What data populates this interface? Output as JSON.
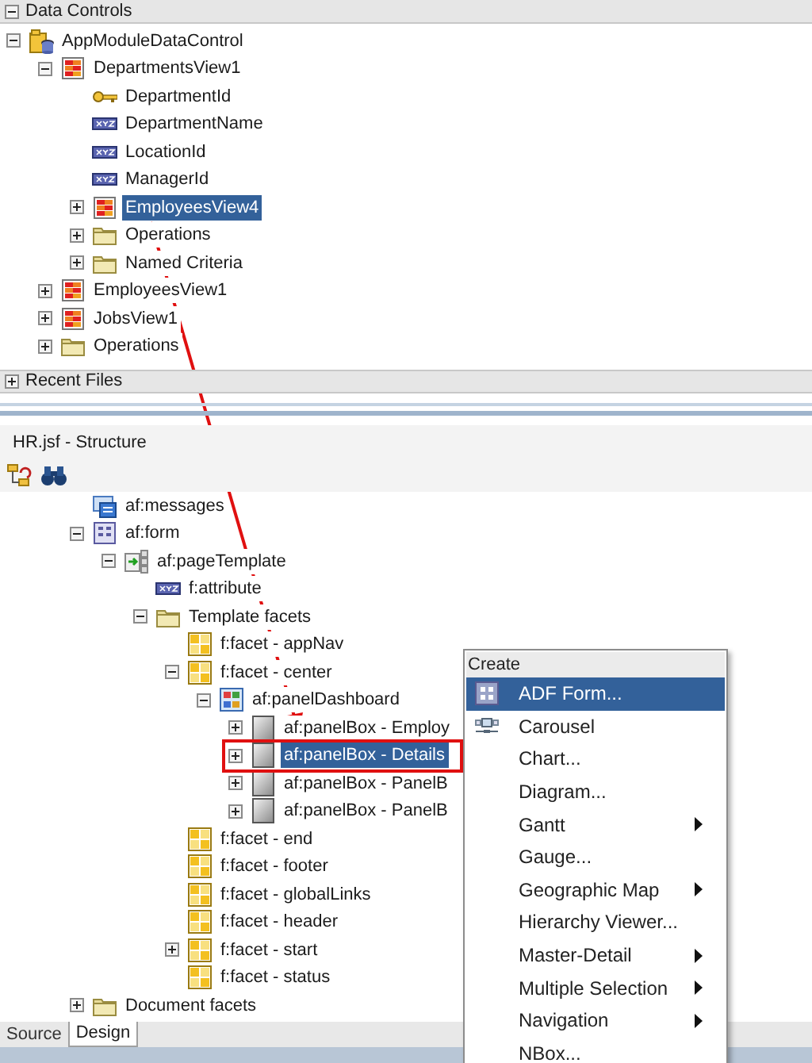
{
  "data_controls": {
    "title": "Data Controls",
    "expanded": true,
    "tree": [
      {
        "label": "AppModuleDataControl",
        "kind": "app-module",
        "expanded": true,
        "selected": false,
        "children": [
          {
            "label": "DepartmentsView1",
            "kind": "view",
            "expanded": true,
            "selected": false,
            "children": [
              {
                "label": "DepartmentId",
                "kind": "key",
                "selected": false
              },
              {
                "label": "DepartmentName",
                "kind": "attribute",
                "selected": false
              },
              {
                "label": "LocationId",
                "kind": "attribute",
                "selected": false
              },
              {
                "label": "ManagerId",
                "kind": "attribute",
                "selected": false
              },
              {
                "label": "EmployeesView4",
                "kind": "view",
                "expanded": false,
                "selected": true
              },
              {
                "label": "Operations",
                "kind": "folder",
                "expanded": false,
                "selected": false
              },
              {
                "label": "Named Criteria",
                "kind": "folder",
                "expanded": false,
                "selected": false
              }
            ]
          },
          {
            "label": "EmployeesView1",
            "kind": "view",
            "expanded": false,
            "selected": false
          },
          {
            "label": "JobsView1",
            "kind": "view",
            "expanded": false,
            "selected": false
          },
          {
            "label": "Operations",
            "kind": "folder",
            "expanded": false,
            "selected": false
          }
        ]
      }
    ]
  },
  "recent_files": {
    "title": "Recent Files",
    "expanded": false
  },
  "structure": {
    "title": "HR.jsf - Structure",
    "tree": [
      {
        "label": "af:messages",
        "kind": "messages",
        "selected": false
      },
      {
        "label": "af:form",
        "kind": "form",
        "expanded": true,
        "selected": false,
        "children": [
          {
            "label": "af:pageTemplate",
            "kind": "template",
            "expanded": true,
            "selected": false,
            "children": [
              {
                "label": "f:attribute",
                "kind": "attribute",
                "selected": false
              },
              {
                "label": "Template facets",
                "kind": "folder",
                "expanded": true,
                "selected": false,
                "children": [
                  {
                    "label": "f:facet - appNav",
                    "kind": "facet",
                    "selected": false
                  },
                  {
                    "label": "f:facet - center",
                    "kind": "facet",
                    "expanded": true,
                    "selected": false,
                    "children": [
                      {
                        "label": "af:panelDashboard",
                        "kind": "dashboard",
                        "expanded": true,
                        "selected": false,
                        "children": [
                          {
                            "label": "af:panelBox - Employ",
                            "kind": "panelbox",
                            "expanded": false,
                            "selected": false
                          },
                          {
                            "label": "af:panelBox - Details",
                            "kind": "panelbox",
                            "expanded": false,
                            "selected": true,
                            "annotated": true
                          },
                          {
                            "label": "af:panelBox - PanelB",
                            "kind": "panelbox",
                            "expanded": false,
                            "selected": false
                          },
                          {
                            "label": "af:panelBox - PanelB",
                            "kind": "panelbox",
                            "expanded": false,
                            "selected": false
                          }
                        ]
                      }
                    ]
                  },
                  {
                    "label": "f:facet - end",
                    "kind": "facet",
                    "selected": false
                  },
                  {
                    "label": "f:facet - footer",
                    "kind": "facet",
                    "selected": false
                  },
                  {
                    "label": "f:facet - globalLinks",
                    "kind": "facet",
                    "selected": false
                  },
                  {
                    "label": "f:facet - header",
                    "kind": "facet",
                    "selected": false
                  },
                  {
                    "label": "f:facet - start",
                    "kind": "facet",
                    "expanded": false,
                    "selected": false
                  },
                  {
                    "label": "f:facet - status",
                    "kind": "facet",
                    "selected": false
                  }
                ]
              }
            ]
          }
        ]
      },
      {
        "label": "Document facets",
        "kind": "folder",
        "expanded": false,
        "selected": false
      }
    ],
    "tabs": [
      {
        "label": "Source",
        "selected": false
      },
      {
        "label": "Design",
        "selected": true
      }
    ]
  },
  "context_menu": {
    "title": "Create",
    "items": [
      {
        "label": "ADF Form...",
        "kind": "form",
        "submenu": false,
        "selected": true
      },
      {
        "label": "Carousel",
        "kind": "carousel",
        "submenu": false,
        "selected": false
      },
      {
        "label": "Chart...",
        "submenu": false,
        "selected": false
      },
      {
        "label": "Diagram...",
        "submenu": false,
        "selected": false
      },
      {
        "label": "Gantt",
        "submenu": true,
        "selected": false
      },
      {
        "label": "Gauge...",
        "submenu": false,
        "selected": false
      },
      {
        "label": "Geographic Map",
        "submenu": true,
        "selected": false
      },
      {
        "label": "Hierarchy Viewer...",
        "submenu": false,
        "selected": false
      },
      {
        "label": "Master-Detail",
        "submenu": true,
        "selected": false
      },
      {
        "label": "Multiple Selection",
        "submenu": true,
        "selected": false
      },
      {
        "label": "Navigation",
        "submenu": true,
        "selected": false
      },
      {
        "label": "NBox...",
        "submenu": false,
        "selected": false
      }
    ]
  }
}
